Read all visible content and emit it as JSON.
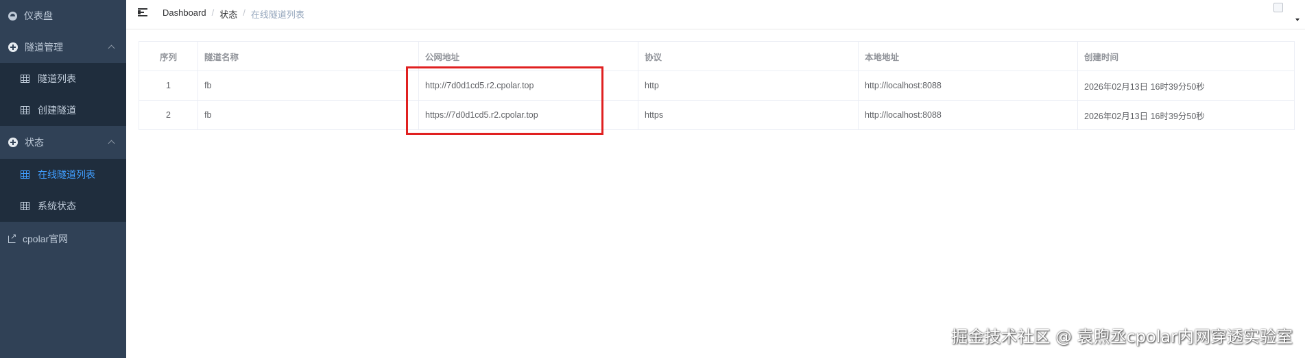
{
  "sidebar": {
    "dashboard": "仪表盘",
    "tunnel_mgmt": {
      "label": "隧道管理",
      "items": [
        "隧道列表",
        "创建隧道"
      ]
    },
    "status": {
      "label": "状态",
      "items": [
        "在线隧道列表",
        "系统状态"
      ]
    },
    "official_site": "cpolar官网",
    "active_item": "在线隧道列表"
  },
  "breadcrumb": [
    "Dashboard",
    "状态",
    "在线隧道列表"
  ],
  "table": {
    "headers": [
      "序列",
      "隧道名称",
      "公网地址",
      "协议",
      "本地地址",
      "创建时间"
    ],
    "rows": [
      [
        "1",
        "fb",
        "http://7d0d1cd5.r2.cpolar.top",
        "http",
        "http://localhost:8088",
        "2026年02月13日 16时39分50秒"
      ],
      [
        "2",
        "fb",
        "https://7d0d1cd5.r2.cpolar.top",
        "https",
        "http://localhost:8088",
        "2026年02月13日 16时39分50秒"
      ]
    ]
  },
  "watermark": "掘金技术社区 @ 袁煦丞cpolar内网穿透实验室",
  "colors": {
    "sidebar_bg": "#304156",
    "submenu_bg": "#1f2d3d",
    "active": "#409eff",
    "highlight": "#e02020"
  }
}
